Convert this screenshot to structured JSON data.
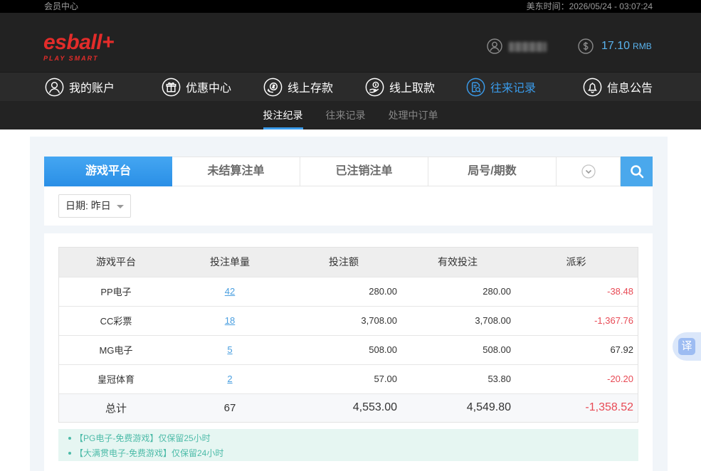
{
  "topbar": {
    "member_center": "会员中心",
    "time": "美东时间：2026/05/24 - 03:07:24"
  },
  "header": {
    "logo": {
      "main": "esball+",
      "tagline": "PLAY SMART"
    },
    "user_icon": "user-circle-icon",
    "balance": {
      "icon": "dollar-circle-icon",
      "amount": "17.10",
      "currency": "RMB"
    }
  },
  "nav": [
    {
      "label": "我的账户",
      "icon": "user-icon",
      "active": false
    },
    {
      "label": "优惠中心",
      "icon": "gift-icon",
      "active": false
    },
    {
      "label": "线上存款",
      "icon": "deposit-icon",
      "active": false
    },
    {
      "label": "线上取款",
      "icon": "withdraw-icon",
      "active": false
    },
    {
      "label": "往来记录",
      "icon": "records-icon",
      "active": true
    },
    {
      "label": "信息公告",
      "icon": "bell-icon",
      "active": false
    }
  ],
  "subnav": [
    {
      "label": "投注纪录",
      "active": true
    },
    {
      "label": "往来记录",
      "active": false
    },
    {
      "label": "处理中订单",
      "active": false
    }
  ],
  "tabs": [
    {
      "label": "游戏平台",
      "active": true
    },
    {
      "label": "未结算注单",
      "active": false
    },
    {
      "label": "已注销注单",
      "active": false
    },
    {
      "label": "局号/期数",
      "active": false
    }
  ],
  "tab_more_icon": "chevron-down-icon",
  "tab_search_icon": "search-icon",
  "filter": {
    "date": "日期: 昨日"
  },
  "table": {
    "headers": [
      "游戏平台",
      "投注单量",
      "投注额",
      "有效投注",
      "派彩"
    ],
    "rows": [
      {
        "platform": "PP电子",
        "count": "42",
        "bet": "280.00",
        "valid": "280.00",
        "payout": "-38.48"
      },
      {
        "platform": "CC彩票",
        "count": "18",
        "bet": "3,708.00",
        "valid": "3,708.00",
        "payout": "-1,367.76"
      },
      {
        "platform": "MG电子",
        "count": "5",
        "bet": "508.00",
        "valid": "508.00",
        "payout": "67.92"
      },
      {
        "platform": "皇冠体育",
        "count": "2",
        "bet": "57.00",
        "valid": "53.80",
        "payout": "-20.20"
      }
    ],
    "total": {
      "label": "总计",
      "count": "67",
      "bet": "4,553.00",
      "valid": "4,549.80",
      "payout": "-1,358.52"
    }
  },
  "notes": [
    "【PG电子-免费游戏】仅保留25小时",
    "【大满贯电子-免费游戏】仅保留24小时"
  ],
  "translate": {
    "label": "译"
  },
  "colors": {
    "accent": "#3a9bea",
    "negative": "#e84a55",
    "link": "#4a9fe0",
    "balance": "#5ab4ef",
    "note_text": "#4cbba8",
    "note_bg": "#e6f6f2",
    "logo_red": "#e32c2a"
  }
}
